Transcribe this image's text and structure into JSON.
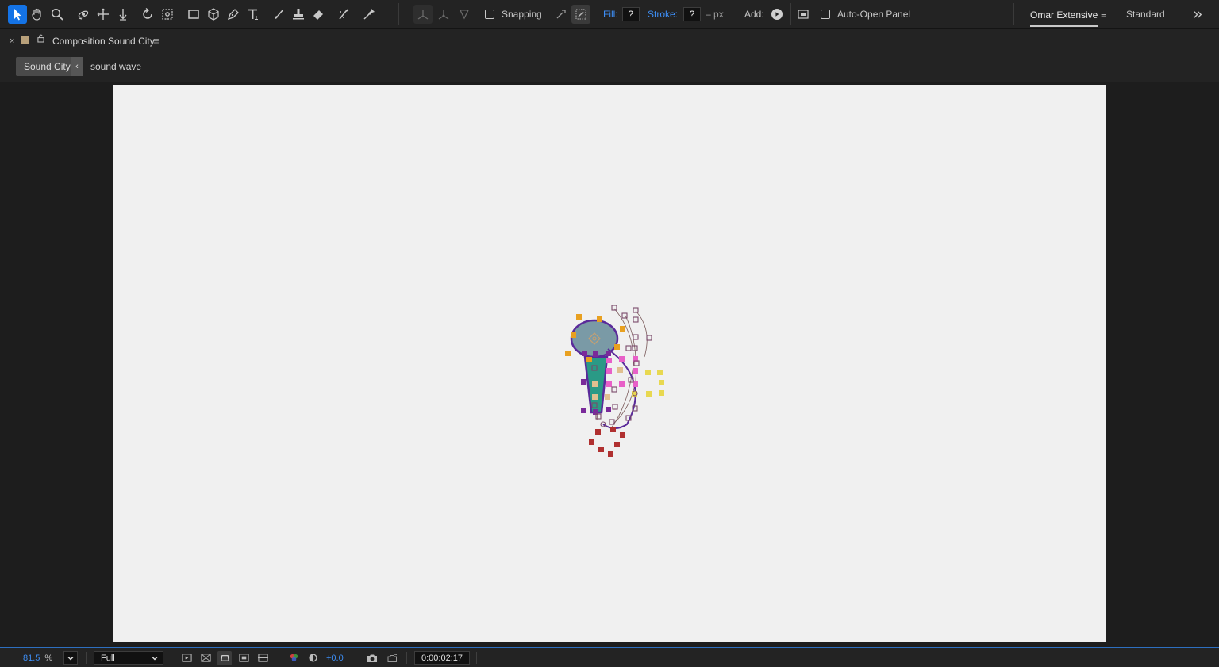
{
  "toolbar": {
    "snapping_label": "Snapping",
    "fill_label": "Fill:",
    "fill_value": "?",
    "stroke_label": "Stroke:",
    "stroke_value": "?",
    "stroke_unit": "– px",
    "add_label": "Add:",
    "auto_open_label": "Auto-Open Panel",
    "workspace_active": "Omar Extensive",
    "workspace_other": "Standard",
    "accent_color": "#1473e6"
  },
  "panel": {
    "close_glyph": "×",
    "title": "Composition Sound City",
    "menu_glyph": "≡"
  },
  "breadcrumb": {
    "items": [
      "Sound City",
      "sound wave"
    ],
    "chevron": "‹"
  },
  "bottombar": {
    "zoom_value": "81.5",
    "zoom_unit": "%",
    "resolution": "Full",
    "exposure": "+0.0",
    "timecode": "0:00:02:17"
  }
}
